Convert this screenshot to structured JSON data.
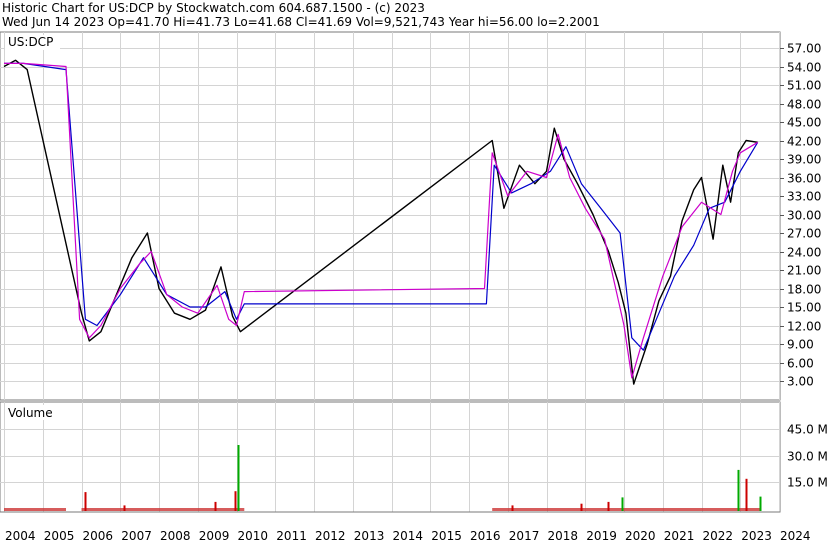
{
  "header": {
    "line1": "Historic Chart for US:DCP by Stockwatch.com 604.687.1500 - (c) 2023",
    "line2": "Wed Jun 14 2023   Op=41.70   Hi=41.73   Lo=41.68   Cl=41.69   Vol=9,521,743   Year hi=56.00   lo=2.2001"
  },
  "chart_data": [
    {
      "type": "line",
      "title": "US:DCP",
      "ylabel": "",
      "yticks": [
        "57.00",
        "54.00",
        "51.00",
        "48.00",
        "45.00",
        "42.00",
        "39.00",
        "36.00",
        "33.00",
        "30.00",
        "27.00",
        "24.00",
        "21.00",
        "18.00",
        "15.00",
        "12.00",
        "9.00",
        "6.00",
        "3.00"
      ],
      "ylim": [
        0,
        60
      ],
      "grid": true,
      "series": [
        {
          "color": "#cc00cc",
          "x": [
            2004.0,
            2004.5,
            2005.6,
            2005.95,
            2006.2,
            2006.5,
            2007.0,
            2007.5,
            2007.8,
            2008.2,
            2008.6,
            2009.0,
            2009.5,
            2009.8,
            2010.0,
            2010.2,
            2016.4,
            2016.6,
            2017.0,
            2017.5,
            2018.0,
            2018.3,
            2018.6,
            2019.0,
            2019.5,
            2020.0,
            2020.2,
            2020.5,
            2020.8,
            2021.0,
            2021.5,
            2022.0,
            2022.5,
            2022.8,
            2023.0,
            2023.45
          ],
          "y": [
            54.5,
            54.5,
            54.0,
            13.0,
            10.0,
            12.0,
            18.0,
            22.0,
            24.0,
            17.0,
            15.0,
            14.0,
            18.5,
            13.0,
            12.0,
            17.5,
            18.0,
            40.0,
            33.0,
            37.0,
            36.0,
            43.0,
            36.0,
            31.0,
            26.0,
            12.0,
            3.5,
            10.0,
            16.0,
            20.0,
            28.0,
            32.0,
            30.0,
            37.0,
            40.0,
            41.7
          ]
        },
        {
          "color": "#0000cc",
          "x": [
            2004.0,
            2004.5,
            2005.6,
            2006.1,
            2006.4,
            2007.0,
            2007.6,
            2008.2,
            2008.8,
            2009.2,
            2009.7,
            2010.0,
            2010.2,
            2016.45,
            2016.65,
            2017.1,
            2017.6,
            2018.1,
            2018.5,
            2018.9,
            2019.4,
            2019.9,
            2020.2,
            2020.5,
            2020.9,
            2021.3,
            2021.8,
            2022.2,
            2022.6,
            2023.0,
            2023.45
          ],
          "y": [
            54.5,
            54.5,
            53.5,
            13.0,
            12.0,
            17.0,
            23.0,
            17.0,
            15.0,
            15.0,
            17.5,
            13.0,
            15.5,
            15.5,
            38.0,
            33.5,
            35.0,
            37.0,
            41.0,
            35.0,
            31.0,
            27.0,
            10.0,
            8.0,
            14.0,
            20.0,
            25.0,
            31.0,
            32.0,
            37.0,
            41.7
          ]
        },
        {
          "color": "#000000",
          "x": [
            2004.0,
            2004.3,
            2004.6,
            2006.0,
            2006.2,
            2006.5,
            2006.9,
            2007.3,
            2007.7,
            2008.0,
            2008.4,
            2008.8,
            2009.2,
            2009.6,
            2009.9,
            2010.1,
            2016.6,
            2016.9,
            2017.3,
            2017.7,
            2018.0,
            2018.2,
            2018.45,
            2018.8,
            2019.2,
            2019.6,
            2019.85,
            2020.05,
            2020.25,
            2020.6,
            2020.9,
            2021.2,
            2021.5,
            2021.8,
            2022.0,
            2022.3,
            2022.55,
            2022.75,
            2022.95,
            2023.15,
            2023.45
          ],
          "y": [
            54.0,
            55.0,
            53.5,
            14.0,
            9.5,
            11.0,
            17.0,
            23.0,
            27.0,
            18.0,
            14.0,
            13.0,
            14.5,
            21.5,
            13.5,
            11.0,
            42.0,
            31.0,
            38.0,
            35.0,
            37.0,
            44.0,
            39.0,
            35.0,
            30.0,
            24.0,
            19.0,
            14.0,
            2.5,
            9.0,
            16.0,
            20.0,
            29.0,
            34.0,
            36.0,
            26.0,
            38.0,
            32.0,
            40.0,
            42.0,
            41.7
          ]
        }
      ]
    },
    {
      "type": "bar",
      "title": "Volume",
      "yticks": [
        "45.0 M",
        "30.0 M",
        "15.0 M"
      ],
      "ylim": [
        0,
        56
      ],
      "grid": true,
      "spikes": [
        {
          "x": 2006.1,
          "value": 9.5,
          "color": "#cc0000"
        },
        {
          "x": 2007.1,
          "value": 2.0,
          "color": "#cc0000"
        },
        {
          "x": 2009.45,
          "value": 4.0,
          "color": "#cc0000"
        },
        {
          "x": 2009.95,
          "value": 10.0,
          "color": "#cc0000"
        },
        {
          "x": 2010.05,
          "value": 36.0,
          "color": "#00aa00"
        },
        {
          "x": 2017.1,
          "value": 2.0,
          "color": "#cc0000"
        },
        {
          "x": 2018.9,
          "value": 3.0,
          "color": "#cc0000"
        },
        {
          "x": 2019.6,
          "value": 4.0,
          "color": "#cc0000"
        },
        {
          "x": 2019.95,
          "value": 6.5,
          "color": "#00aa00"
        },
        {
          "x": 2022.95,
          "value": 22.0,
          "color": "#00aa00"
        },
        {
          "x": 2023.15,
          "value": 17.0,
          "color": "#cc0000"
        },
        {
          "x": 2023.5,
          "value": 7.0,
          "color": "#00aa00"
        }
      ],
      "segments": [
        [
          2004.0,
          2005.6
        ],
        [
          2006.0,
          2010.2
        ],
        [
          2016.6,
          2023.5
        ]
      ]
    }
  ],
  "x_axis": {
    "labels": [
      "2004",
      "2005",
      "2006",
      "2007",
      "2008",
      "2009",
      "2010",
      "2011",
      "2012",
      "2013",
      "2014",
      "2015",
      "2016",
      "2017",
      "2018",
      "2019",
      "2020",
      "2021",
      "2022",
      "2023",
      "2024"
    ]
  }
}
